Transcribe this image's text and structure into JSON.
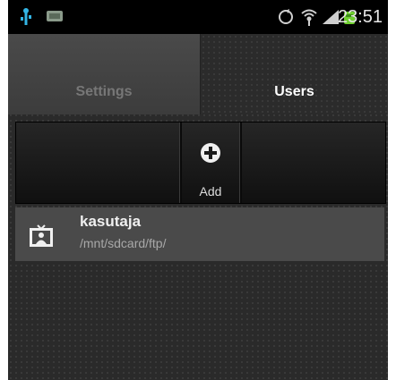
{
  "status_bar": {
    "time": "23:51",
    "icons": [
      "usb-debug-icon",
      "notification-icon",
      "sync-icon",
      "wifi-icon",
      "signal-icon",
      "battery-icon"
    ]
  },
  "tabs": [
    {
      "label": "Settings",
      "selected": false
    },
    {
      "label": "Users",
      "selected": true
    }
  ],
  "action_bar": {
    "add_label": "Add",
    "add_icon": "plus-circle-icon"
  },
  "users": [
    {
      "name": "kasutaja",
      "path": "/mnt/sdcard/ftp/",
      "icon": "user-badge-icon"
    }
  ],
  "colors": {
    "background": "#2a2a2a",
    "list_item_bg": "#4a4a4a",
    "accent_usb": "#33b5e5",
    "battery": "#6fcf2f"
  }
}
